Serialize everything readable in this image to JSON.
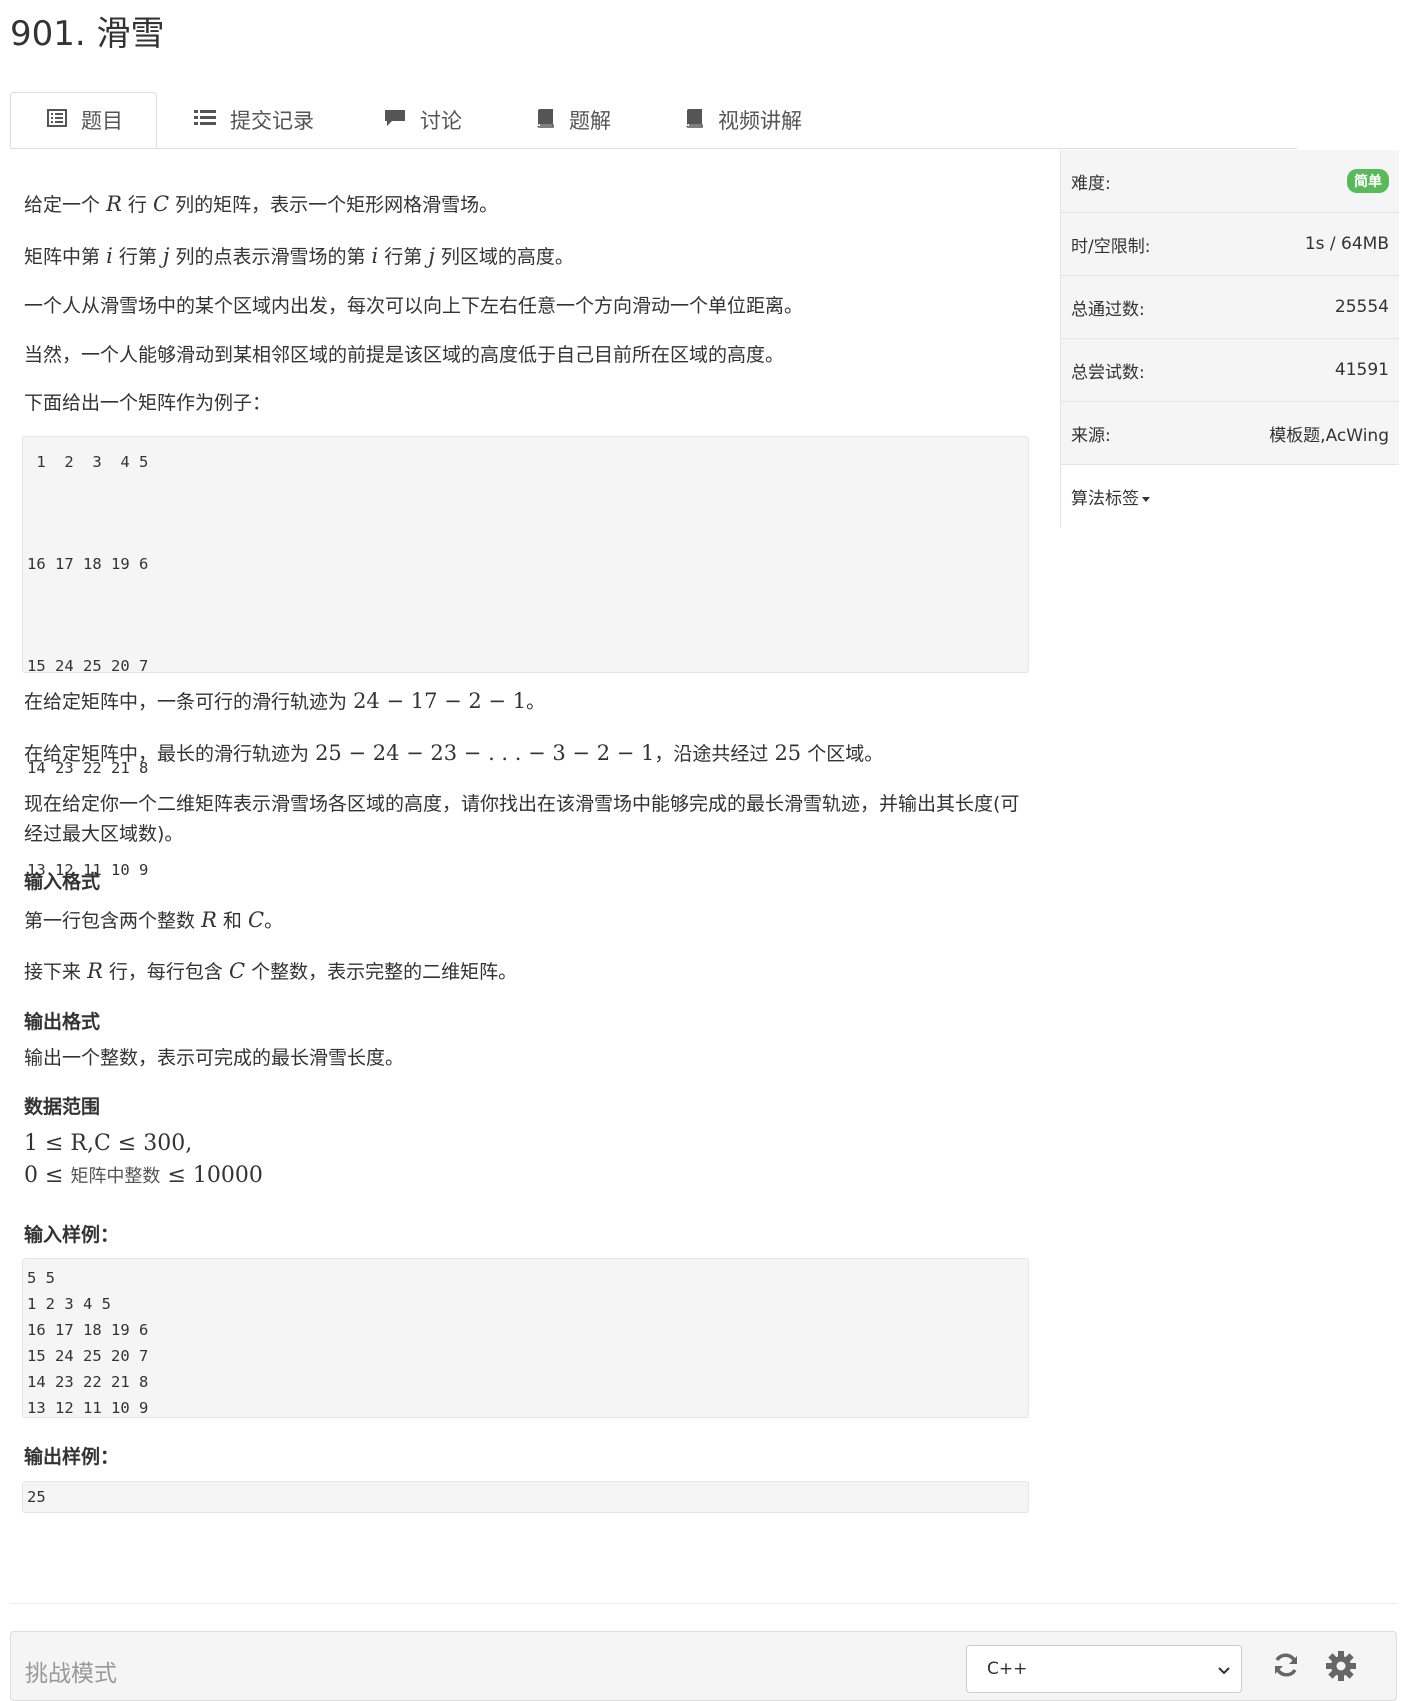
{
  "title": "901. 滑雪",
  "tabs": [
    {
      "label": "题目",
      "icon": "list-icon",
      "active": true
    },
    {
      "label": "提交记录",
      "icon": "list-lines-icon"
    },
    {
      "label": "讨论",
      "icon": "comment-icon"
    },
    {
      "label": "题解",
      "icon": "book-icon"
    },
    {
      "label": "视频讲解",
      "icon": "book-icon"
    }
  ],
  "sidebar": {
    "difficulty_label": "难度:",
    "difficulty_value": "简单",
    "difficulty_color": "#5cb85c",
    "limit_label": "时/空限制:",
    "limit_value": "1s / 64MB",
    "accepted_label": "总通过数:",
    "accepted_value": "25554",
    "attempts_label": "总尝试数:",
    "attempts_value": "41591",
    "source_label": "来源:",
    "source_value": "模板题,AcWing",
    "tags_label": "算法标签"
  },
  "problem": {
    "p1": {
      "a": "给定一个",
      "R": "R",
      "b": "行",
      "C": "C",
      "c": "列的矩阵，表示一个矩形网格滑雪场。"
    },
    "p2": {
      "a": "矩阵中第",
      "i": "i",
      "b": "行第",
      "j": "j",
      "c": "列的点表示滑雪场的第",
      "i2": "i",
      "d": "行第",
      "j2": "j",
      "e": "列区域的高度。"
    },
    "p3": "一个人从滑雪场中的某个区域内出发，每次可以向上下左右任意一个方向滑动一个单位距离。",
    "p4": "当然，一个人能够滑动到某相邻区域的前提是该区域的高度低于自己目前所在区域的高度。",
    "p5": "下面给出一个矩阵作为例子：",
    "example_matrix": " 1  2  3  4 5\n\n16 17 18 19 6\n\n15 24 25 20 7\n\n14 23 22 21 8\n\n13 12 11 10 9",
    "p6": {
      "a": "在给定矩阵中，一条可行的滑行轨迹为",
      "expr": "24 − 17 − 2 − 1",
      "b": "。"
    },
    "p7": {
      "a": "在给定矩阵中，最长的滑行轨迹为",
      "expr": "25 − 24 − 23 − . . . − 3 − 2 − 1",
      "b": "，沿途共经过",
      "n": "25",
      "c": "个区域。"
    },
    "p8": "现在给定你一个二维矩阵表示滑雪场各区域的高度，请你找出在该滑雪场中能够完成的最长滑雪轨迹，并输出其长度(可经过最大区域数)。",
    "input_h": "输入格式",
    "input_p1": {
      "a": "第一行包含两个整数",
      "R": "R",
      "b": "和",
      "C": "C",
      "c": "。"
    },
    "input_p2": {
      "a": "接下来",
      "R": "R",
      "b": "行，每行包含",
      "C": "C",
      "c": "个整数，表示完整的二维矩阵。"
    },
    "output_h": "输出格式",
    "output_p": "输出一个整数，表示可完成的最长滑雪长度。",
    "range_h": "数据范围",
    "range_1": "1 ≤ R,C ≤ 300,",
    "range_2a": "0 ≤",
    "range_2b": "矩阵中整数",
    "range_2c": "≤ 10000",
    "sample_in_h": "输入样例：",
    "sample_in": "5 5\n1 2 3 4 5\n16 17 18 19 6\n15 24 25 20 7\n14 23 22 21 8\n13 12 11 10 9",
    "sample_out_h": "输出样例：",
    "sample_out": "25"
  },
  "editor": {
    "mode_label": "挑战模式",
    "language": "C++"
  }
}
